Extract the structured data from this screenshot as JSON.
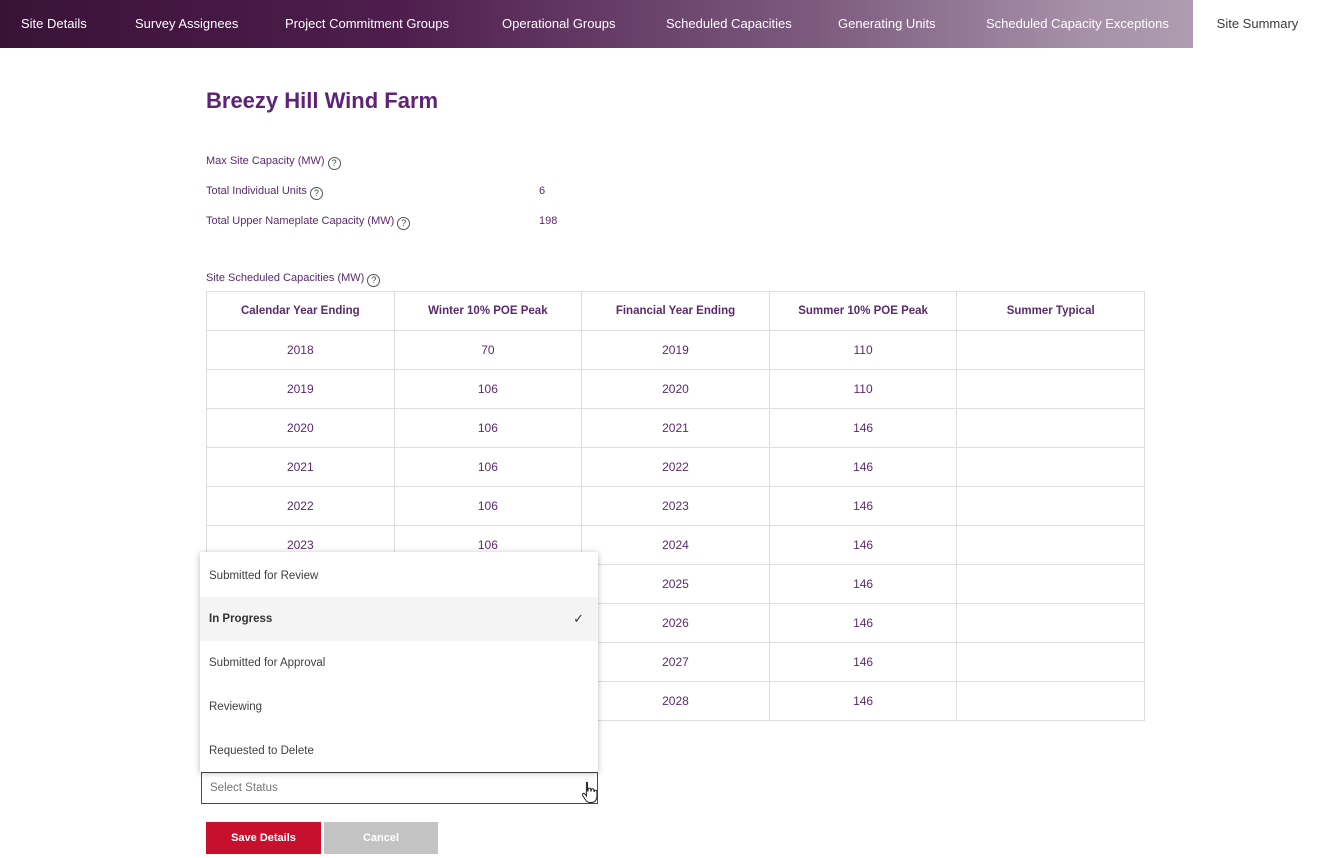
{
  "tabs": [
    {
      "label": "Site Details"
    },
    {
      "label": "Survey Assignees"
    },
    {
      "label": "Project Commitment Groups"
    },
    {
      "label": "Operational Groups"
    },
    {
      "label": "Scheduled Capacities"
    },
    {
      "label": "Generating Units"
    },
    {
      "label": "Scheduled Capacity Exceptions"
    },
    {
      "label": "Site Summary",
      "active": true
    }
  ],
  "site": {
    "title": "Breezy Hill Wind Farm",
    "max_capacity_label": "Max Site Capacity (MW)",
    "max_capacity_value": "",
    "total_units_label": "Total Individual Units",
    "total_units_value": "6",
    "total_nameplate_label": "Total Upper Nameplate Capacity (MW)",
    "total_nameplate_value": "198",
    "help_glyph": "?"
  },
  "capacities": {
    "title": "Site Scheduled Capacities (MW)",
    "headers": [
      "Calendar Year Ending",
      "Winter 10% POE Peak",
      "Financial Year Ending",
      "Summer 10% POE Peak",
      "Summer Typical"
    ],
    "rows": [
      [
        "2018",
        "70",
        "2019",
        "110",
        ""
      ],
      [
        "2019",
        "106",
        "2020",
        "110",
        ""
      ],
      [
        "2020",
        "106",
        "2021",
        "146",
        ""
      ],
      [
        "2021",
        "106",
        "2022",
        "146",
        ""
      ],
      [
        "2022",
        "106",
        "2023",
        "146",
        ""
      ],
      [
        "2023",
        "106",
        "2024",
        "146",
        ""
      ],
      [
        "",
        "",
        "2025",
        "146",
        ""
      ],
      [
        "",
        "",
        "2026",
        "146",
        ""
      ],
      [
        "",
        "",
        "2027",
        "146",
        ""
      ],
      [
        "",
        "",
        "2028",
        "146",
        ""
      ]
    ]
  },
  "status_dropdown": {
    "options": [
      {
        "label": "Submitted for Review"
      },
      {
        "label": "In Progress",
        "selected": true
      },
      {
        "label": "Submitted for Approval"
      },
      {
        "label": "Reviewing"
      },
      {
        "label": "Requested to Delete"
      }
    ],
    "check_glyph": "✓",
    "placeholder": "Select Status",
    "value": ""
  },
  "buttons": {
    "save_label": "Save Details",
    "cancel_label": "Cancel"
  },
  "colors": {
    "accent_purple": "#5e2277",
    "save_red": "#c8102e",
    "cancel_gray": "#c3c3c3"
  },
  "icons": {
    "help": "help-circle-icon",
    "check": "check-icon",
    "cursor": "hand-pointer-icon"
  }
}
